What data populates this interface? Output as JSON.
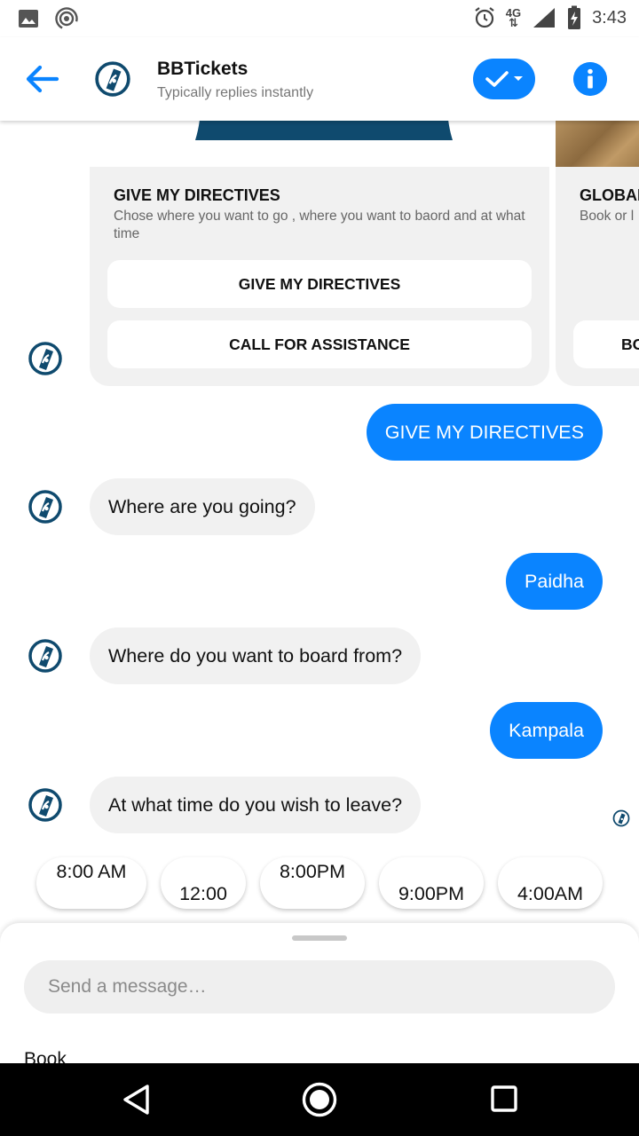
{
  "status_bar": {
    "time": "3:43",
    "network": "4G"
  },
  "header": {
    "title": "BBTickets",
    "subtitle": "Typically replies instantly"
  },
  "cards": [
    {
      "title": "GIVE MY DIRECTIVES",
      "description": "Chose  where you want to go , where you want to baord and at what time",
      "buttons": [
        "GIVE MY DIRECTIVES",
        "CALL FOR ASSISTANCE"
      ]
    },
    {
      "title": "GLOBAL",
      "description": "Book or l",
      "buttons": [
        "BO"
      ]
    }
  ],
  "messages": [
    {
      "from": "user",
      "text": "GIVE MY DIRECTIVES"
    },
    {
      "from": "bot",
      "text": "Where are you going?"
    },
    {
      "from": "user",
      "text": "Paidha"
    },
    {
      "from": "bot",
      "text": "Where do you want to board from?"
    },
    {
      "from": "user",
      "text": "Kampala"
    },
    {
      "from": "bot",
      "text": "At what time do you wish to leave?"
    }
  ],
  "quick_replies": [
    "8:00 AM",
    "12:00",
    "8:00PM",
    "9:00PM",
    "4:00AM"
  ],
  "composer": {
    "placeholder": "Send a message…",
    "menu_peek": "Book"
  },
  "colors": {
    "accent": "#0a84ff",
    "bot_bubble": "#f1f1f1",
    "logo_navy": "#0f4a6e"
  }
}
